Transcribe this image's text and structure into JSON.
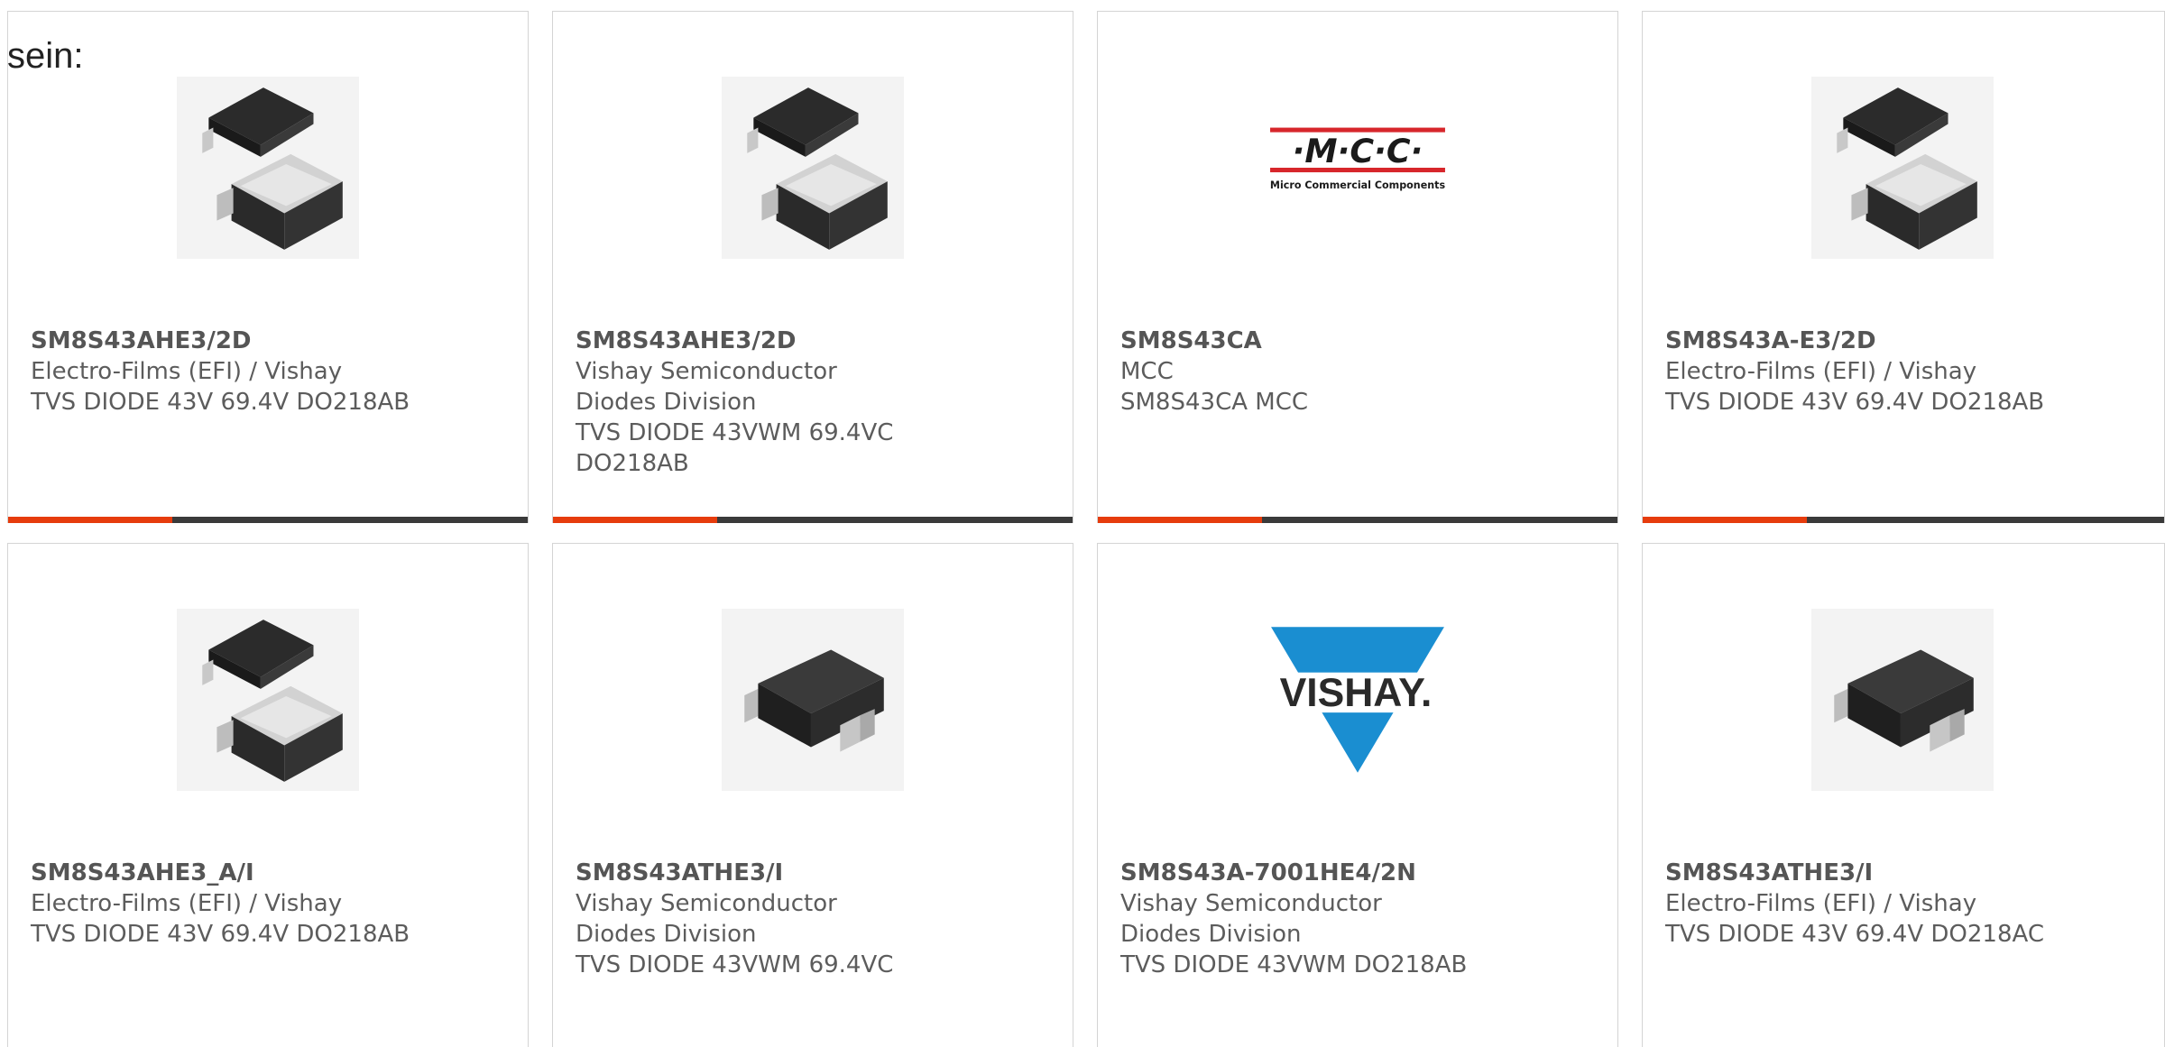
{
  "intro_text": "sein:",
  "colors": {
    "accent": "#e63c0d",
    "bar": "#3a3a3a",
    "border": "#d4d4d4",
    "text": "#5c5c5c",
    "mcc_red": "#d7262b",
    "vishay_blue": "#1a8ed1"
  },
  "cards": [
    {
      "part_number": "SM8S43AHE3/2D",
      "manufacturer": "Electro-Films (EFI) / Vishay",
      "description": "TVS DIODE 43V 69.4V DO218AB",
      "image": "diode-do218ab-pair-icon"
    },
    {
      "part_number": "SM8S43AHE3/2D",
      "manufacturer": "Vishay Semiconductor Diodes Division",
      "description": "TVS DIODE 43VWM 69.4VC DO218AB",
      "image": "diode-do218ab-pair-icon"
    },
    {
      "part_number": "SM8S43CA",
      "manufacturer": "MCC",
      "description": "SM8S43CA MCC",
      "image": "mcc-logo",
      "logo_text": "·M·C·C·",
      "logo_subtext": "Micro Commercial Components"
    },
    {
      "part_number": "SM8S43A-E3/2D",
      "manufacturer": "Electro-Films (EFI) / Vishay",
      "description": "TVS DIODE 43V 69.4V DO218AB",
      "image": "diode-do218ab-pair-icon"
    },
    {
      "part_number": "SM8S43AHE3_A/I",
      "manufacturer": "Electro-Films (EFI) / Vishay",
      "description": "TVS DIODE 43V 69.4V DO218AB",
      "image": "diode-do218ab-pair-icon"
    },
    {
      "part_number": "SM8S43ATHE3/I",
      "manufacturer": "Vishay Semiconductor Diodes Division",
      "description": "TVS DIODE 43VWM 69.4VC",
      "image": "diode-do218ac-icon"
    },
    {
      "part_number": "SM8S43A-7001HE4/2N",
      "manufacturer": "Vishay Semiconductor Diodes Division",
      "description": "TVS DIODE 43VWM DO218AB",
      "image": "vishay-logo",
      "logo_text": "VISHAY."
    },
    {
      "part_number": "SM8S43ATHE3/I",
      "manufacturer": "Electro-Films (EFI) / Vishay",
      "description": "TVS DIODE 43V 69.4V DO218AC",
      "image": "diode-do218ac-icon"
    }
  ]
}
